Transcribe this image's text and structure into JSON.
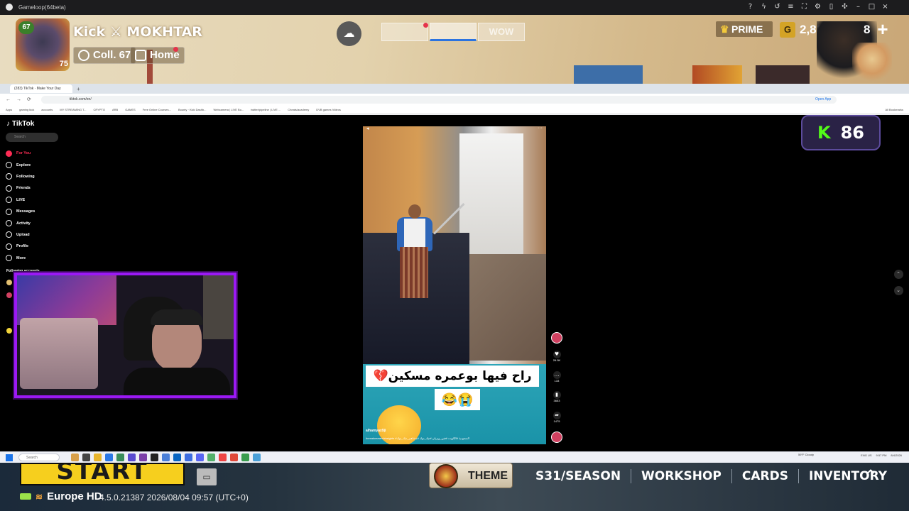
{
  "gameloop": {
    "title": "Gameloop(64beta)",
    "controls": [
      "help-icon",
      "lightning-icon",
      "rotate-icon",
      "menu-icon",
      "fullscreen-icon",
      "settings-icon",
      "sidebar-icon",
      "pin-icon",
      "minimize-icon",
      "maximize-icon",
      "close-icon"
    ]
  },
  "hud": {
    "player_name": "Kick ⚔ MOKHTAR",
    "level": "67",
    "avatar_number": "75",
    "collection_label": "Coll. 67",
    "home_label": "Home",
    "modes": [
      "",
      "",
      "WOW"
    ],
    "prime_label": "PRIME",
    "currency_value": "2,835",
    "currency_letter": "G",
    "extra_value": "8",
    "plus_label": "+",
    "kick_viewers": "86",
    "kick_letter": "K"
  },
  "browser": {
    "tab_title": "(283) TikTok · Make Your Day",
    "tab_plus": "+",
    "url": "tiktok.com/en/",
    "bookmarks": [
      "Apps",
      "gaming kick",
      "accounts",
      "MY STREAMING T...",
      "CRYPTO",
      "ARB",
      "GAMES",
      "Free Online Courses...",
      "Bounty · Kick Dashb...",
      "Webcamera | LIVE Bo...",
      "twitter/pipeline | LIVE ...",
      "Cheats/academy",
      "DVB games Videos",
      "All Bookmarks"
    ],
    "open_label": "Open App"
  },
  "tiktok": {
    "logo": "TikTok",
    "search_placeholder": "Search",
    "nav": [
      {
        "label": "For You",
        "active": true
      },
      {
        "label": "Explore",
        "active": false
      },
      {
        "label": "Following",
        "active": false
      },
      {
        "label": "Friends",
        "active": false
      },
      {
        "label": "LIVE",
        "active": false
      },
      {
        "label": "Messages",
        "active": false
      },
      {
        "label": "Activity",
        "active": false
      },
      {
        "label": "Upload",
        "active": false
      },
      {
        "label": "Profile",
        "active": false
      },
      {
        "label": "More",
        "active": false
      }
    ],
    "following_header": "Following accounts",
    "video": {
      "caption_line1": "راح فيها بوعمره مسكين💔",
      "caption_line2": "😂😭",
      "username": "alhamyax9ji",
      "hashtags": "#creatorsearchinsights #السعودية #الكويت #فين_ويزيان #تيك_توك #مشاهير_تيك_توك"
    },
    "actions": [
      {
        "icon": "heart-icon",
        "count": "26.5K"
      },
      {
        "icon": "comment-icon",
        "count": "133"
      },
      {
        "icon": "bookmark-icon",
        "count": "3653"
      },
      {
        "icon": "share-icon",
        "count": "1475"
      }
    ]
  },
  "taskbar": {
    "search_placeholder": "Search",
    "weather": "59°F Cloudy",
    "lang": "ENG US",
    "time": "9:57 PM",
    "date": "8/4/2026"
  },
  "game_bottom": {
    "start_label": "START",
    "server": "Europe HD",
    "version": "4.5.0.21387 2026/08/04 09:57 (UTC+0)",
    "theme_label": "THEME",
    "tabs": [
      "S31/SEASON",
      "WORKSHOP",
      "CARDS",
      "INVENTORY"
    ]
  }
}
